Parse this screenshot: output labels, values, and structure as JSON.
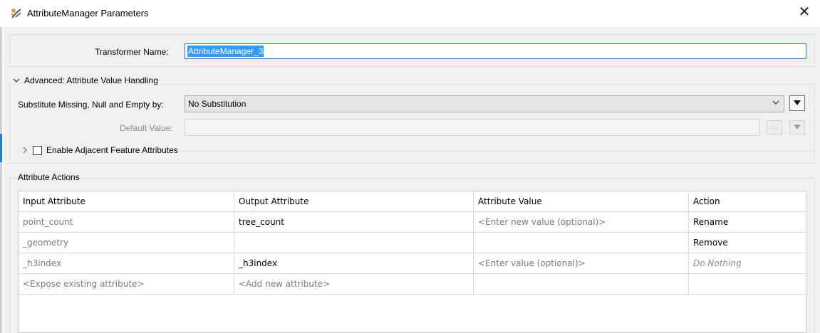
{
  "window": {
    "title": "AttributeManager Parameters",
    "close_glyph": "✕"
  },
  "transformer": {
    "label": "Transformer Name:",
    "value": "AttributeManager_3"
  },
  "advanced": {
    "header": "Advanced: Attribute Value Handling",
    "substitute_label": "Substitute Missing, Null and Empty by:",
    "substitute_value": "No Substitution",
    "default_value_label": "Default Value:",
    "default_value": "",
    "dots_label": "..."
  },
  "adjacent": {
    "label": "Enable Adjacent Feature Attributes",
    "checked": false
  },
  "attribute_actions": {
    "header": "Attribute Actions",
    "columns": [
      "Input Attribute",
      "Output Attribute",
      "Attribute Value",
      "Action"
    ],
    "rows": [
      {
        "input": "point_count",
        "output": "tree_count",
        "value": "<Enter new value (optional)>",
        "action": "Rename"
      },
      {
        "input": "_geometry",
        "output": "",
        "value": "",
        "action": "Remove"
      },
      {
        "input": "_h3index",
        "output": "_h3index",
        "value": "<Enter value (optional)>",
        "action": "Do Nothing"
      },
      {
        "input": "<Expose existing attribute>",
        "output": "<Add new attribute>",
        "value": "",
        "action": ""
      }
    ]
  },
  "icons": {
    "app": "fme-transformer-icon",
    "collapse": "chevron-down-icon",
    "expand": "chevron-right-icon",
    "dropdown": "dropdown-caret-icon",
    "menu": "triangle-down-menu-icon"
  },
  "colors": {
    "accent": "#2a78c8",
    "selection": "#3399ff",
    "panel": "#f0f0f0"
  }
}
